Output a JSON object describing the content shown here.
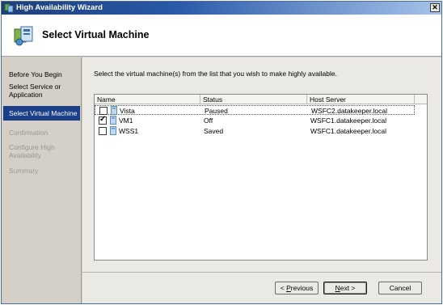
{
  "window": {
    "title": "High Availability Wizard",
    "close_glyph": "✕"
  },
  "header": {
    "title": "Select Virtual Machine",
    "icon": "wizard-vm-icon"
  },
  "sidebar": {
    "steps": [
      {
        "label": "Before You Begin",
        "state": "done"
      },
      {
        "label": "Select Service or Application",
        "state": "done"
      },
      {
        "label": "Select Virtual Machine",
        "state": "active"
      },
      {
        "label": "Confirmation",
        "state": "disabled"
      },
      {
        "label": "Configure High Availability",
        "state": "disabled"
      },
      {
        "label": "Summary",
        "state": "disabled"
      }
    ]
  },
  "main": {
    "instruction": "Select the virtual machine(s) from the list that you wish to make highly available.",
    "columns": [
      "Name",
      "Status",
      "Host Server"
    ],
    "rows": [
      {
        "name": "Vista",
        "status": "Paused",
        "host": "WSFC2.datakeeper.local",
        "checked": false
      },
      {
        "name": "VM1",
        "status": "Off",
        "host": "WSFC1.datakeeper.local",
        "checked": true
      },
      {
        "name": "WSS1",
        "status": "Saved",
        "host": "WSFC1.datakeeper.local",
        "checked": false
      }
    ]
  },
  "buttons": {
    "previous": {
      "prefix": "< ",
      "mnemonic": "P",
      "rest": "revious"
    },
    "next": {
      "mnemonic": "N",
      "rest": "ext >"
    },
    "cancel": "Cancel"
  },
  "colors": {
    "active_step": "#1b3f86",
    "titlebar": "#2a5aa8"
  }
}
